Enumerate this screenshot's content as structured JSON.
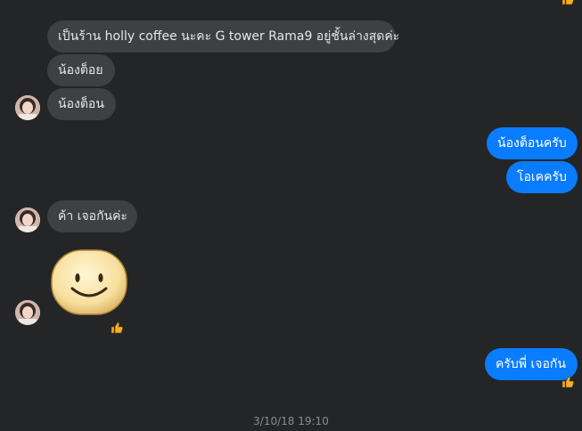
{
  "messages": {
    "m1": "เป็นร้าน holly coffee นะคะ G tower Rama9 อยู่ชั้นล่างสุดค่ะ",
    "m2": "น้องต็อย",
    "m3": "น้องต็อน",
    "m4": "น้องต็อนครับ",
    "m5": "โอเคครับ",
    "m6": "ค้า เจอกันค่ะ",
    "m7_sticker": "smiley-face-sticker",
    "m8": "ครับพี่ เจอกัน"
  },
  "reactions": {
    "icon": "thumbs-up-icon",
    "color": "#f7b125"
  },
  "timestamp": "3/10/18 19:10",
  "colors": {
    "background": "#242526",
    "incoming_bubble": "#3e4042",
    "outgoing_bubble": "#0a7cff"
  }
}
